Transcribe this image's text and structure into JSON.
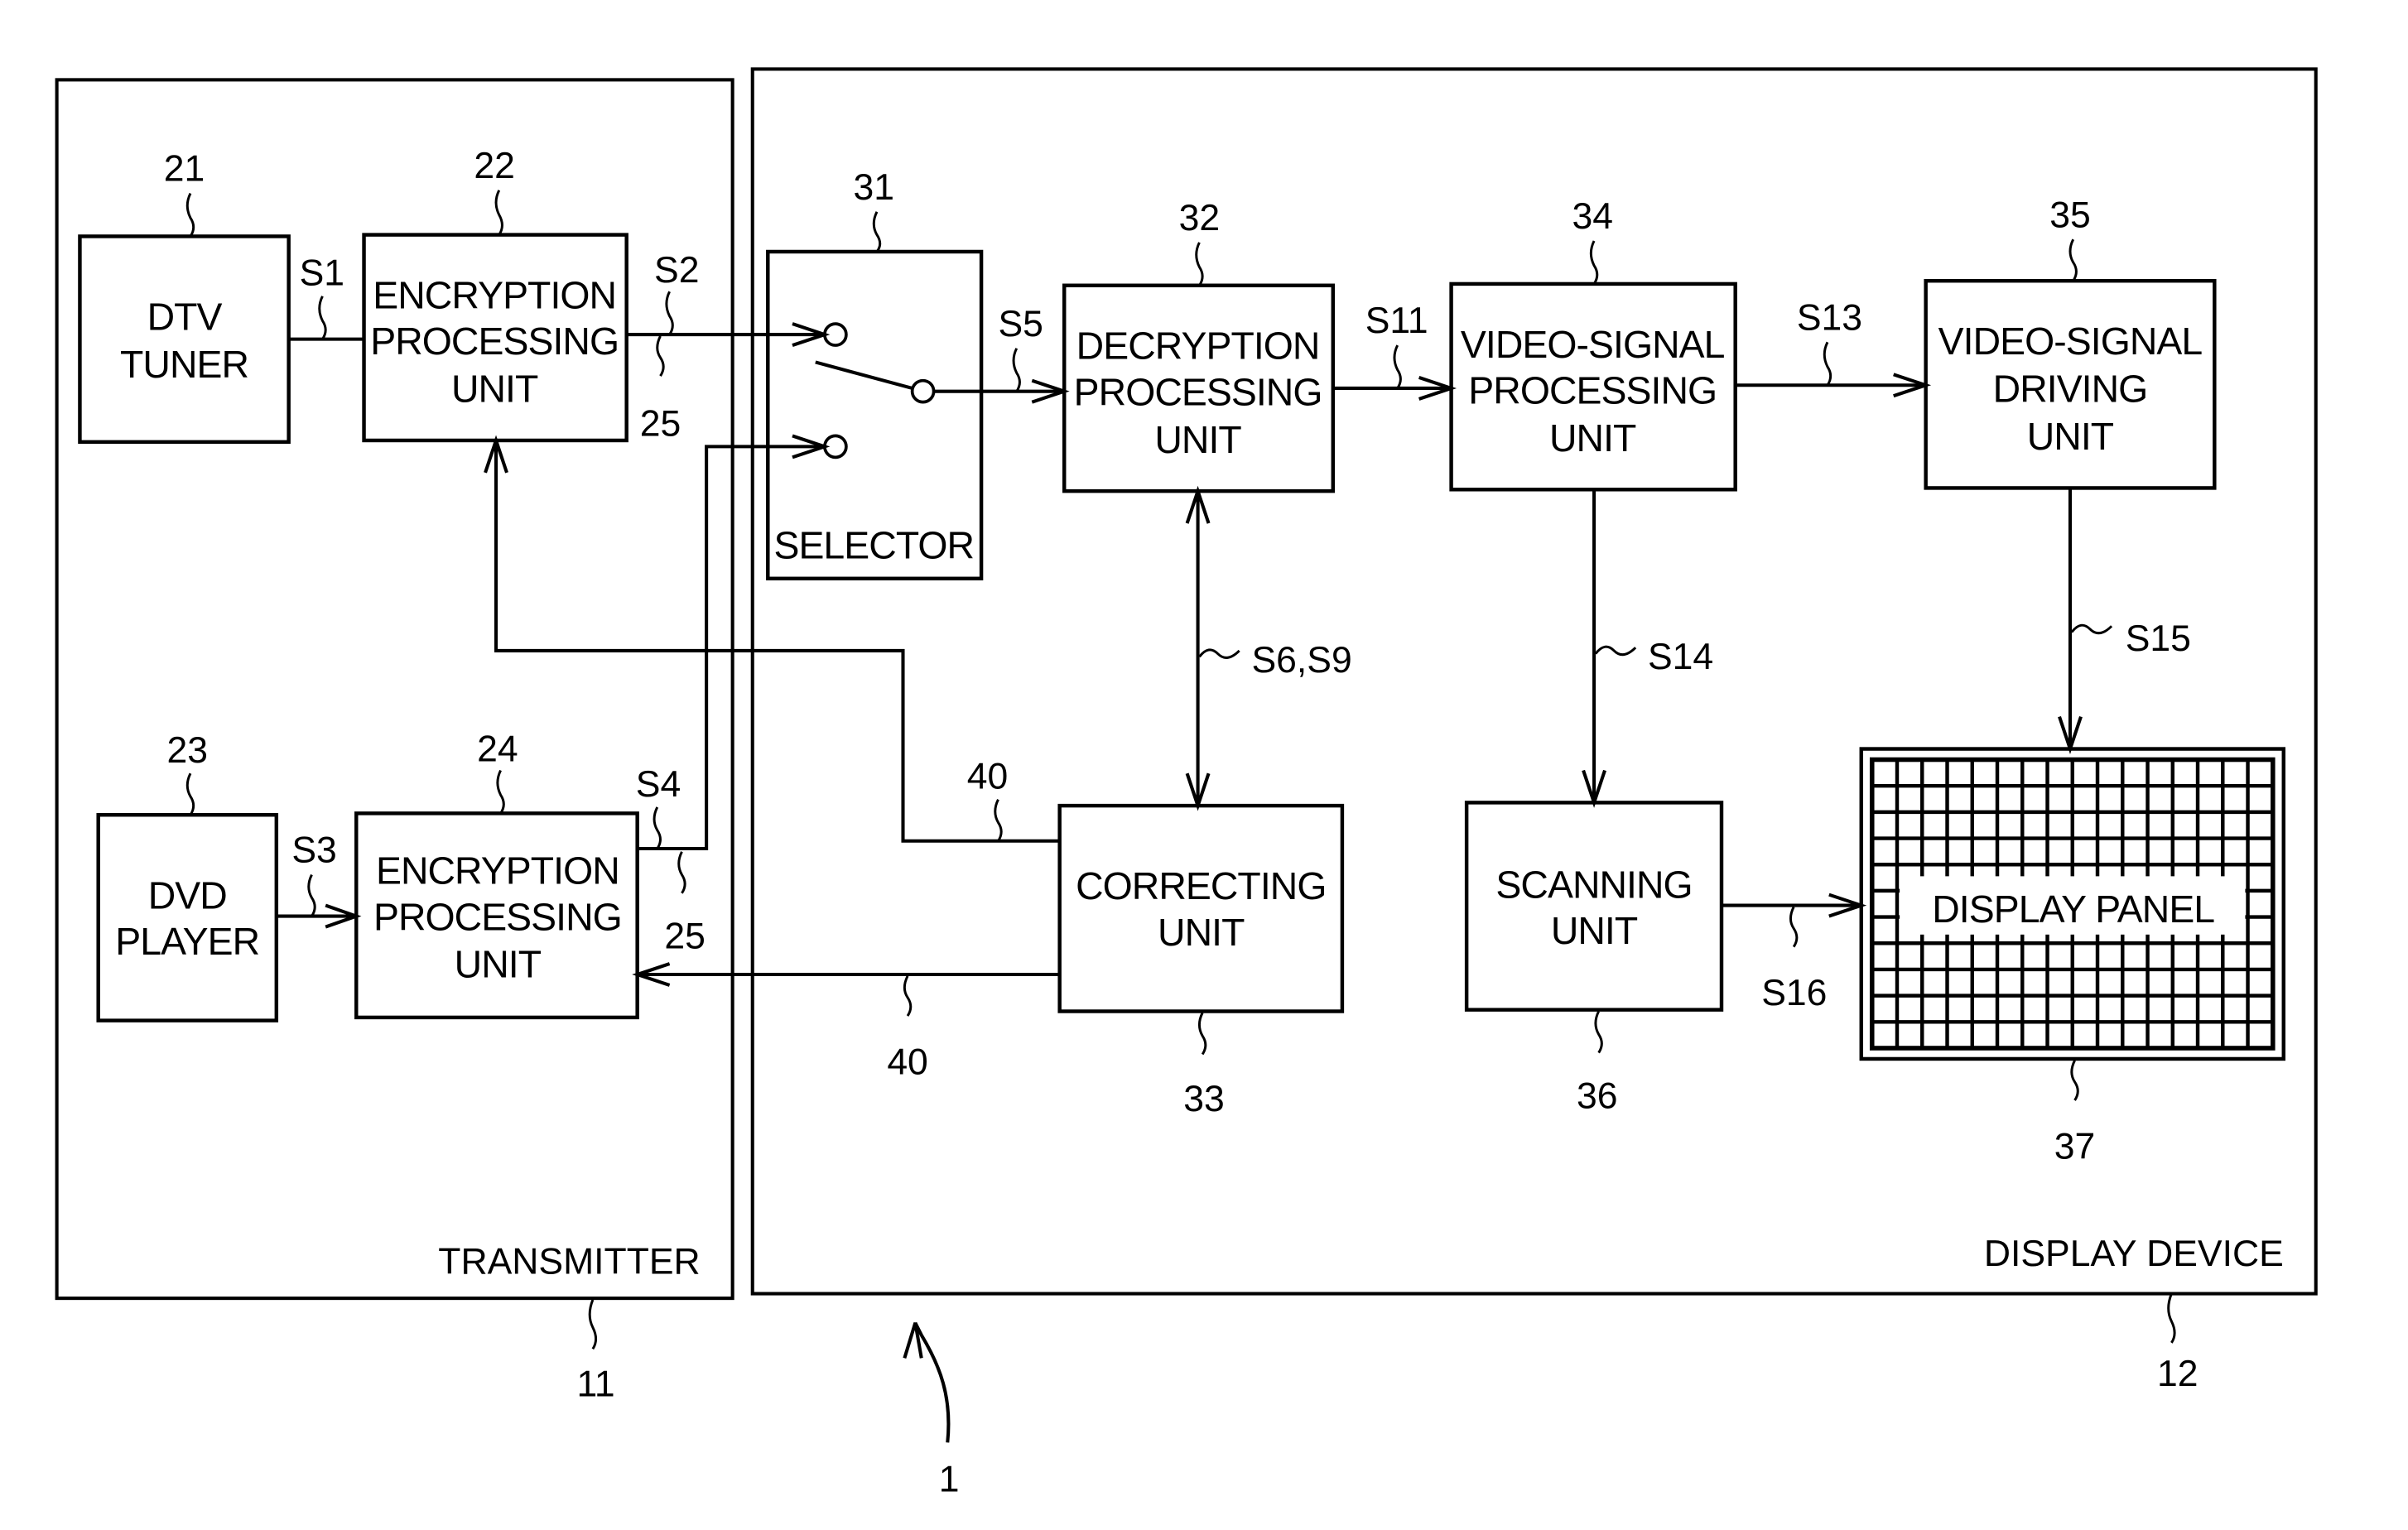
{
  "figure": {
    "system_ref": "1",
    "transmitter": {
      "label": "TRANSMITTER",
      "ref": "11",
      "blocks": {
        "dtv_tuner": {
          "ref": "21",
          "lines": [
            "DTV",
            "TUNER"
          ]
        },
        "encryption_1": {
          "ref": "22",
          "lines": [
            "ENCRYPTION",
            "PROCESSING",
            "UNIT"
          ]
        },
        "dvd_player": {
          "ref": "23",
          "lines": [
            "DVD",
            "PLAYER"
          ]
        },
        "encryption_2": {
          "ref": "24",
          "lines": [
            "ENCRYPTION",
            "PROCESSING",
            "UNIT"
          ]
        }
      },
      "link_ref_upper": "25",
      "link_ref_lower": "25"
    },
    "display_device": {
      "label": "DISPLAY DEVICE",
      "ref": "12",
      "blocks": {
        "selector": {
          "ref": "31",
          "lines": [
            "SELECTOR"
          ]
        },
        "decryption": {
          "ref": "32",
          "lines": [
            "DECRYPTION",
            "PROCESSING",
            "UNIT"
          ]
        },
        "correcting": {
          "ref": "33",
          "lines": [
            "CORRECTING",
            "UNIT"
          ]
        },
        "video_processing": {
          "ref": "34",
          "lines": [
            "VIDEO-SIGNAL",
            "PROCESSING",
            "UNIT"
          ]
        },
        "video_driving": {
          "ref": "35",
          "lines": [
            "VIDEO-SIGNAL",
            "DRIVING",
            "UNIT"
          ]
        },
        "scanning": {
          "ref": "36",
          "lines": [
            "SCANNING",
            "UNIT"
          ]
        },
        "display_panel": {
          "ref": "37",
          "lines": [
            "DISPLAY PANEL"
          ],
          "grid_cols": 16,
          "grid_rows": 11
        }
      }
    },
    "feedback_ref_upper": "40",
    "feedback_ref_lower": "40",
    "signals": {
      "s1": "S1",
      "s2": "S2",
      "s3": "S3",
      "s4": "S4",
      "s5": "S5",
      "s6_s9": "S6,S9",
      "s11": "S11",
      "s13": "S13",
      "s14": "S14",
      "s15": "S15",
      "s16": "S16"
    }
  }
}
